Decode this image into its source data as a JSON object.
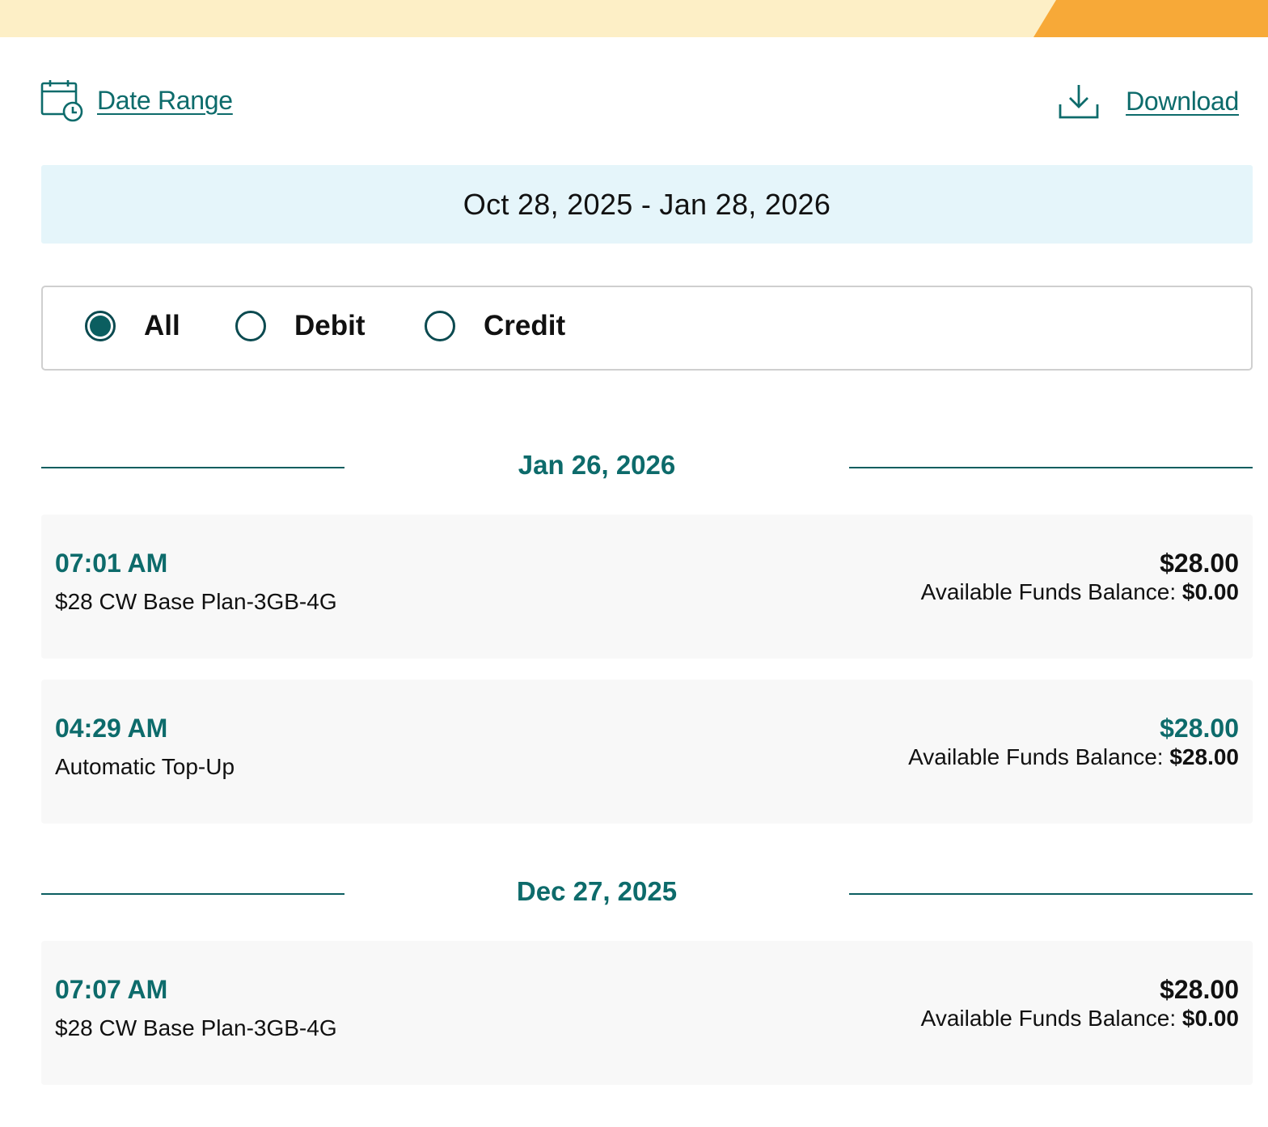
{
  "header": {
    "date_range_label": "Date Range",
    "download_label": "Download",
    "colors": {
      "brand": "#0d6b6b",
      "banner": "#fdefc6",
      "banner_accent": "#f7a938",
      "range_bg": "#e5f5fa"
    }
  },
  "range": {
    "text": "Oct 28, 2025 - Jan 28, 2026"
  },
  "filters": {
    "selected": "All",
    "options": [
      "All",
      "Debit",
      "Credit"
    ]
  },
  "groups": [
    {
      "date": "Jan 26, 2026",
      "transactions": [
        {
          "time": "07:01 AM",
          "description": "$28 CW Base Plan-3GB-4G",
          "amount": "$28.00",
          "kind": "debit",
          "balance_label": "Available Funds Balance:",
          "balance_value": "$0.00"
        },
        {
          "time": "04:29 AM",
          "description": "Automatic Top-Up",
          "amount": "$28.00",
          "kind": "credit",
          "balance_label": "Available Funds Balance:",
          "balance_value": "$28.00"
        }
      ]
    },
    {
      "date": "Dec 27, 2025",
      "transactions": [
        {
          "time": "07:07 AM",
          "description": "$28 CW Base Plan-3GB-4G",
          "amount": "$28.00",
          "kind": "debit",
          "balance_label": "Available Funds Balance:",
          "balance_value": "$0.00"
        }
      ]
    }
  ]
}
